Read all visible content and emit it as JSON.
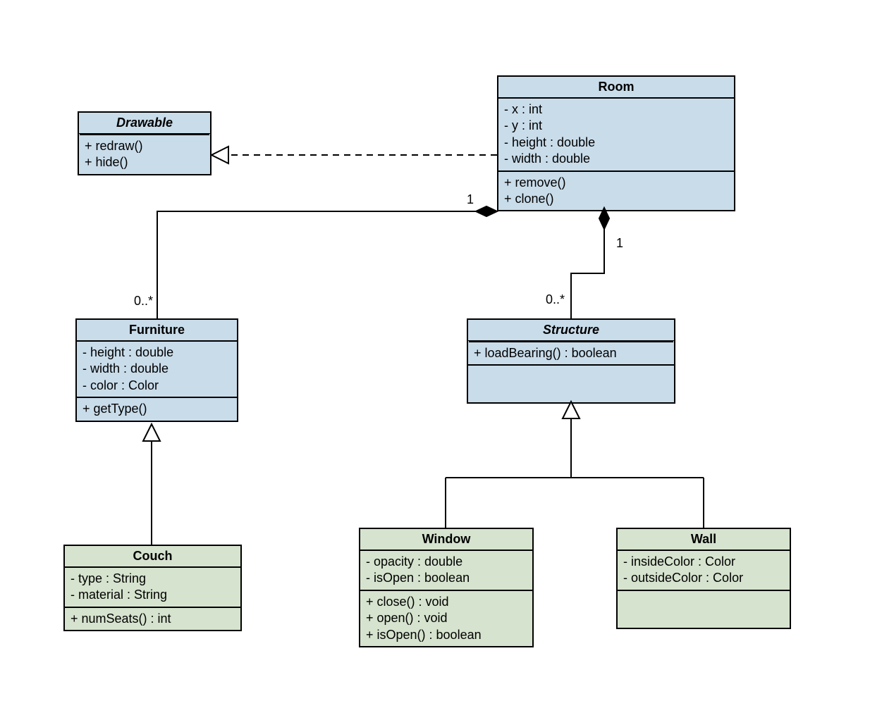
{
  "classes": {
    "drawable": {
      "name": "Drawable",
      "methods": [
        "+ redraw()",
        "+ hide()"
      ]
    },
    "room": {
      "name": "Room",
      "attrs": [
        "- x : int",
        "- y : int",
        "- height : double",
        "- width : double"
      ],
      "methods": [
        "+ remove()",
        "+ clone()"
      ]
    },
    "furniture": {
      "name": "Furniture",
      "attrs": [
        "- height : double",
        "- width : double",
        "- color : Color"
      ],
      "methods": [
        "+ getType()"
      ]
    },
    "structure": {
      "name": "Structure",
      "methods": [
        "+ loadBearing() : boolean"
      ]
    },
    "couch": {
      "name": "Couch",
      "attrs": [
        "- type : String",
        "- material : String"
      ],
      "methods": [
        "+ numSeats() : int"
      ]
    },
    "window": {
      "name": "Window",
      "attrs": [
        "- opacity : double",
        "- isOpen : boolean"
      ],
      "methods": [
        "+ close() : void",
        "+ open() : void",
        "+ isOpen() : boolean"
      ]
    },
    "wall": {
      "name": "Wall",
      "attrs": [
        "- insideColor : Color",
        "- outsideColor : Color"
      ]
    }
  },
  "multiplicities": {
    "room_furn_room": "1",
    "room_furn_furn": "0..*",
    "room_struct_room": "1",
    "room_struct_struct": "0..*"
  },
  "relationships": [
    {
      "from": "Room",
      "to": "Drawable",
      "type": "realization"
    },
    {
      "from": "Room",
      "to": "Furniture",
      "type": "composition",
      "whole_mult": "1",
      "part_mult": "0..*"
    },
    {
      "from": "Room",
      "to": "Structure",
      "type": "composition",
      "whole_mult": "1",
      "part_mult": "0..*"
    },
    {
      "from": "Couch",
      "to": "Furniture",
      "type": "generalization"
    },
    {
      "from": "Window",
      "to": "Structure",
      "type": "generalization"
    },
    {
      "from": "Wall",
      "to": "Structure",
      "type": "generalization"
    }
  ]
}
